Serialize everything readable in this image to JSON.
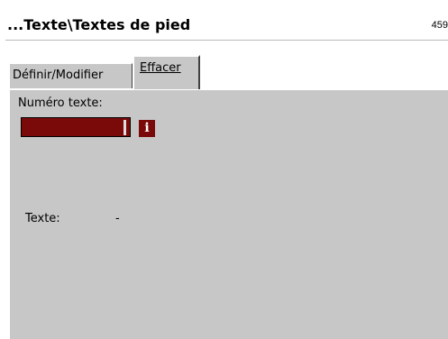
{
  "window": {
    "title": "...Texte\\Textes de pied",
    "code": "459"
  },
  "tabs": [
    {
      "label": "Définir/Modifier",
      "active": false
    },
    {
      "label": "Effacer",
      "active": true
    }
  ],
  "form": {
    "numero_label": "Numéro texte:",
    "numero_value": "",
    "info_icon": "info-icon",
    "texte_label": "Texte:",
    "texte_value": "-"
  },
  "colors": {
    "input_bg": "#7a0a0a",
    "panel_bg": "#c7c7c7"
  }
}
